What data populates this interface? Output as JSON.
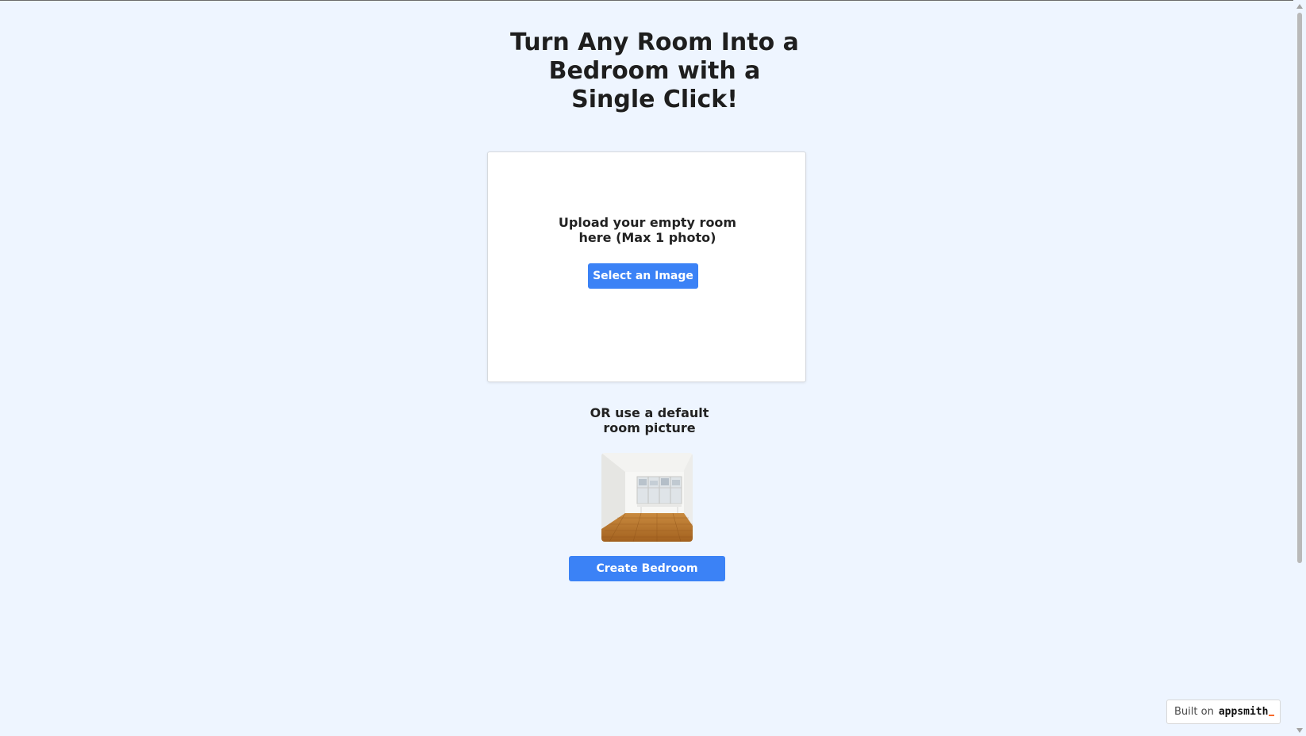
{
  "page": {
    "heading_lines": [
      "Turn Any Room Into a",
      "Bedroom with a",
      "Single Click!"
    ]
  },
  "upload": {
    "label_lines": [
      "Upload your empty room",
      "here (Max 1 photo)"
    ],
    "select_button": "Select an Image"
  },
  "default_room": {
    "label_lines": [
      "OR use a default",
      "room picture"
    ],
    "thumbnail_icon": "room-photo-icon"
  },
  "actions": {
    "create_button": "Create Bedroom"
  },
  "footer": {
    "built_on": "Built on",
    "brand": "appsmith"
  },
  "colors": {
    "background": "#eef5ff",
    "primary": "#3b82f6",
    "brand_accent": "#f86a2b"
  }
}
